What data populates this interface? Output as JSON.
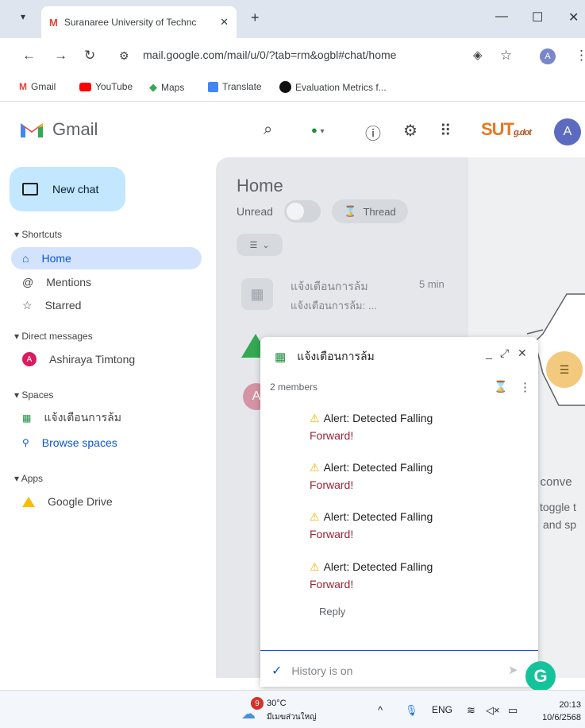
{
  "browser": {
    "tab_title": "Suranaree University of Technc",
    "tab_close": "✕",
    "new_tab": "+",
    "window_controls": {
      "minimize": "—",
      "maximize": "☐",
      "close": "✕"
    },
    "url": "mail.google.com/mail/u/0/?tab=rm&ogbl#chat/home",
    "profile_initial": "A",
    "bookmarks": [
      "Gmail",
      "YouTube",
      "Maps",
      "Translate",
      "Evaluation Metrics f..."
    ]
  },
  "header": {
    "app_name": "Gmail",
    "brand_logo_text": "SUT",
    "brand_logo_sub": "g.dot",
    "avatar_initial": "A"
  },
  "sidebar": {
    "new_chat": "New chat",
    "shortcuts_label": "Shortcuts",
    "shortcuts": [
      {
        "label": "Home",
        "icon": "home-icon",
        "active": true
      },
      {
        "label": "Mentions",
        "icon": "at-icon"
      },
      {
        "label": "Starred",
        "icon": "star-icon"
      }
    ],
    "direct_messages_label": "Direct messages",
    "direct_messages": [
      {
        "label": "Ashiraya Timtong",
        "initial": "A"
      }
    ],
    "spaces_label": "Spaces",
    "spaces": [
      {
        "label": "แจ้งเตือนการล้ม"
      }
    ],
    "browse_spaces": "Browse spaces",
    "apps_label": "Apps",
    "apps": [
      {
        "label": "Google Drive"
      }
    ]
  },
  "home": {
    "title": "Home",
    "unread_label": "Unread",
    "thread_chip": "Thread",
    "conversations": [
      {
        "name": "แจ้งเตือนการล้ม",
        "time": "5 min",
        "snippet": "แจ้งเตือนการล้ม: ..."
      }
    ],
    "third_avatar_initial": "A",
    "empty_state_title": "o conve",
    "empty_state_line1": "toggle t",
    "empty_state_line2": "and sp"
  },
  "chat": {
    "title": "แจ้งเตือนการล้ม",
    "members": "2 members",
    "messages": [
      {
        "line1": "Alert: Detected Falling",
        "line2": "Forward!"
      },
      {
        "line1": "Alert: Detected Falling",
        "line2": "Forward!"
      },
      {
        "line1": "Alert: Detected Falling",
        "line2": "Forward!"
      },
      {
        "line1": "Alert: Detected Falling",
        "line2": "Forward!"
      }
    ],
    "reply": "Reply",
    "compose_placeholder": "History is on"
  },
  "taskbar": {
    "weather_badge": "9",
    "temperature": "30°C",
    "weather_desc": "มีเมฆส่วนใหญ่",
    "language": "ENG",
    "time": "20:13",
    "date": "10/6/2568"
  },
  "colors": {
    "accent": "#0b57d0",
    "new_chat_bg": "#c2e7ff",
    "active_item_bg": "#d3e3fd",
    "space_icon": "#1e8e3e",
    "alert_text": "#9b2335"
  }
}
